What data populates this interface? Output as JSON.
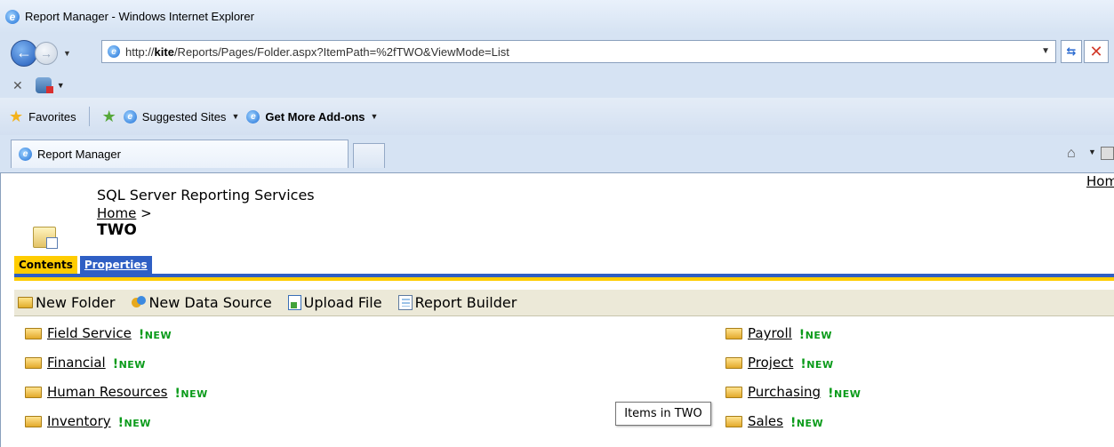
{
  "window": {
    "title": "Report Manager - Windows Internet Explorer"
  },
  "address_bar": {
    "url_prefix": "http://",
    "url_host": "kite",
    "url_rest": "/Reports/Pages/Folder.aspx?ItemPath=%2fTWO&ViewMode=List"
  },
  "favorites_bar": {
    "favorites_label": "Favorites",
    "suggested_sites": "Suggested Sites",
    "get_addons": "Get More Add-ons"
  },
  "tabs": {
    "active_tab": "Report Manager"
  },
  "page": {
    "site_title": "SQL Server Reporting Services",
    "breadcrumb_home": "Home",
    "breadcrumb_sep": ">",
    "folder_title": "TWO",
    "top_link": "Hom",
    "page_tabs": {
      "contents": "Contents",
      "properties": "Properties"
    },
    "toolbar": {
      "new_folder": "New Folder",
      "new_data_source": "New Data Source",
      "upload_file": "Upload File",
      "report_builder": "Report Builder"
    },
    "items_left": [
      {
        "name": "Field Service",
        "badge": "NEW"
      },
      {
        "name": "Financial",
        "badge": "NEW"
      },
      {
        "name": "Human Resources",
        "badge": "NEW"
      },
      {
        "name": "Inventory",
        "badge": "NEW"
      }
    ],
    "items_right": [
      {
        "name": "Payroll",
        "badge": "NEW"
      },
      {
        "name": "Project",
        "badge": "NEW"
      },
      {
        "name": "Purchasing",
        "badge": "NEW"
      },
      {
        "name": "Sales",
        "badge": "NEW"
      }
    ],
    "tooltip": "Items in TWO"
  },
  "colors": {
    "tab_active": "#ffcc00",
    "tab_inactive": "#2f5fc4",
    "new_badge": "#0a9b1a",
    "toolbar_bg": "#ece9d8"
  }
}
